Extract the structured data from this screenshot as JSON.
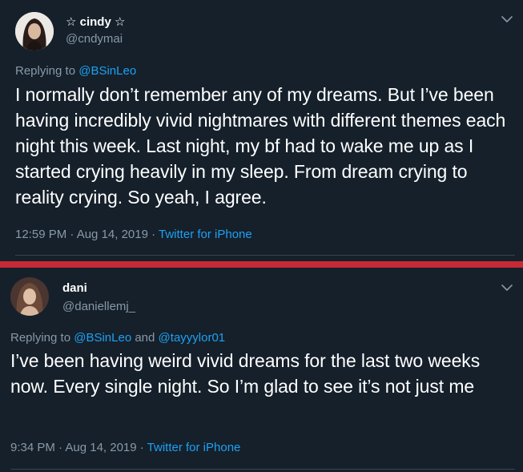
{
  "tweets": [
    {
      "display_name": "☆ cindy ☆",
      "handle": "@cndymai",
      "replying_prefix": "Replying to ",
      "reply_to_1": "@BSinLeo",
      "text": "I normally don’t remember any of my dreams. But I’ve been having incredibly vivid nightmares with different themes each night this week. Last night, my bf had to wake me up as I started crying heavily in my sleep. From dream crying to reality crying. So yeah, I agree.",
      "timestamp": "12:59 PM · Aug 14, 2019 · ",
      "source": "Twitter for iPhone"
    },
    {
      "display_name": "dani",
      "handle": "@daniellemj_",
      "replying_prefix": "Replying to ",
      "reply_to_1": "@BSinLeo",
      "reply_joiner": " and ",
      "reply_to_2": "@tayyylor01",
      "text": "I’ve been having weird vivid dreams for the last two weeks now. Every single night. So I’m glad to see it’s not just me",
      "timestamp": "9:34 PM · Aug 14, 2019 · ",
      "source": "Twitter for iPhone"
    }
  ],
  "colors": {
    "background": "#15202b",
    "divider": "#c72a35",
    "link": "#1da1f2",
    "muted": "#8899a6"
  },
  "icons": {
    "menu": "chevron-down-icon"
  }
}
